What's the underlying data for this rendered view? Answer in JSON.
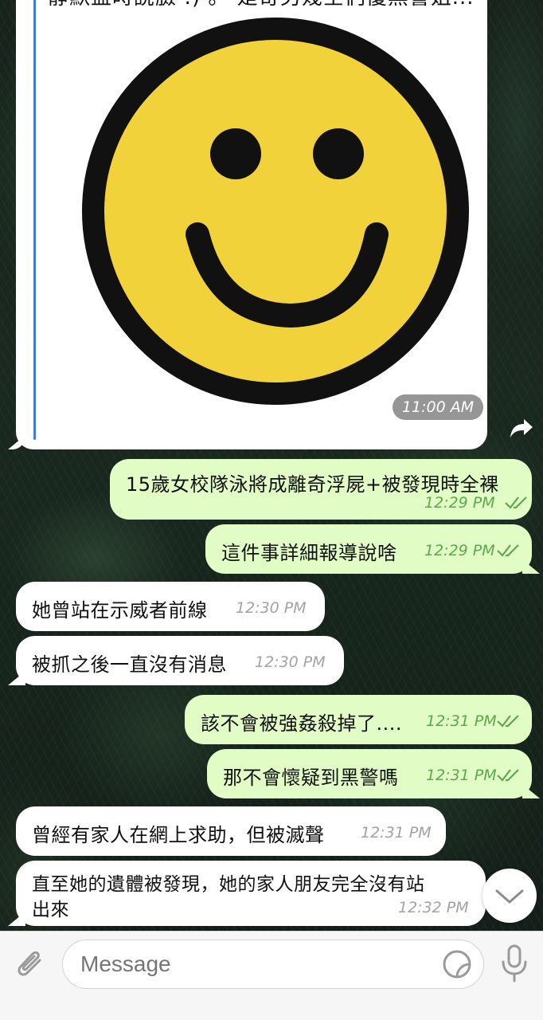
{
  "colors": {
    "outgoing_bubble": "#e2fcc6",
    "incoming_bubble": "#ffffff",
    "outgoing_time": "#5da94d",
    "incoming_time": "#a3a3a3",
    "quote_accent": "#3f7be0",
    "smiley_fill": "#f2d23a"
  },
  "image_message": {
    "cut_off_caption": "靜默盃時說臉 :) 。 是奇另幾空們優黑警姐...",
    "image_icon": "smiley-face",
    "time": "11:00 AM",
    "forward_icon": "forward-arrow-icon"
  },
  "messages": [
    {
      "side": "out",
      "text": "15歲女校隊泳將成離奇浮屍+被發現時全裸",
      "time": "12:29 PM"
    },
    {
      "side": "out",
      "text": "這件事詳細報導說啥",
      "time": "12:29 PM"
    },
    {
      "side": "in",
      "text": "她曾站在示威者前線",
      "time": "12:30 PM"
    },
    {
      "side": "in",
      "text": "被抓之後一直沒有消息",
      "time": "12:30 PM"
    },
    {
      "side": "out",
      "text": "該不會被強姦殺掉了....",
      "time": "12:31 PM"
    },
    {
      "side": "out",
      "text": "那不會懷疑到黑警嗎",
      "time": "12:31 PM"
    },
    {
      "side": "in",
      "text": "曾經有家人在網上求助，但被滅聲",
      "time": "12:31 PM"
    },
    {
      "side": "in",
      "text_line1": "直至她的遺體被發現，她的家人朋友完全沒有站",
      "text_line2": "出來",
      "time": "12:32 PM"
    }
  ],
  "input_bar": {
    "placeholder": "Message",
    "attach_icon": "paperclip-icon",
    "sticker_icon": "sticker-icon",
    "mic_icon": "microphone-icon"
  },
  "scroll_down_icon": "chevron-down-icon"
}
